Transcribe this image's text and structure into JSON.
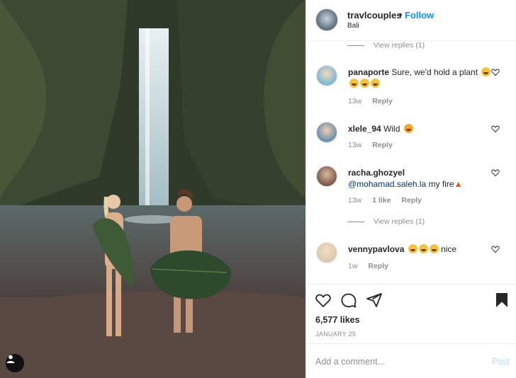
{
  "post": {
    "username": "travlcouples",
    "separator": "•",
    "follow_label": "Follow",
    "location": "Bali",
    "likes": "6,577 likes",
    "date": "JANUARY 25"
  },
  "comments": [
    {
      "type": "view_replies",
      "label": "View replies (1)"
    },
    {
      "user": "panaporte",
      "text": "Sure, we'd hold a plant",
      "emoji_count": 4,
      "time": "13w",
      "reply": "Reply"
    },
    {
      "user": "xlele_94",
      "text": "Wild",
      "emoji": "cat",
      "time": "13w",
      "reply": "Reply"
    },
    {
      "user": "racha.ghozyel",
      "mention": "@mohamad.saleh.la",
      "text": "my fire",
      "time": "13w",
      "likes": "1 like",
      "reply": "Reply"
    },
    {
      "type": "view_replies",
      "label": "View replies (1)"
    },
    {
      "user": "vennypavlova",
      "text": "nice",
      "emoji_count": 3,
      "time": "1w",
      "reply": "Reply"
    }
  ],
  "composer": {
    "placeholder": "Add a comment...",
    "post_label": "Post"
  },
  "icons": [
    "heart-icon",
    "comment-icon",
    "share-icon",
    "bookmark-icon",
    "user-tag-icon"
  ],
  "colors": {
    "accent": "#0095f6",
    "post_disabled": "#b2dffc",
    "muted": "#8e8e8e"
  }
}
